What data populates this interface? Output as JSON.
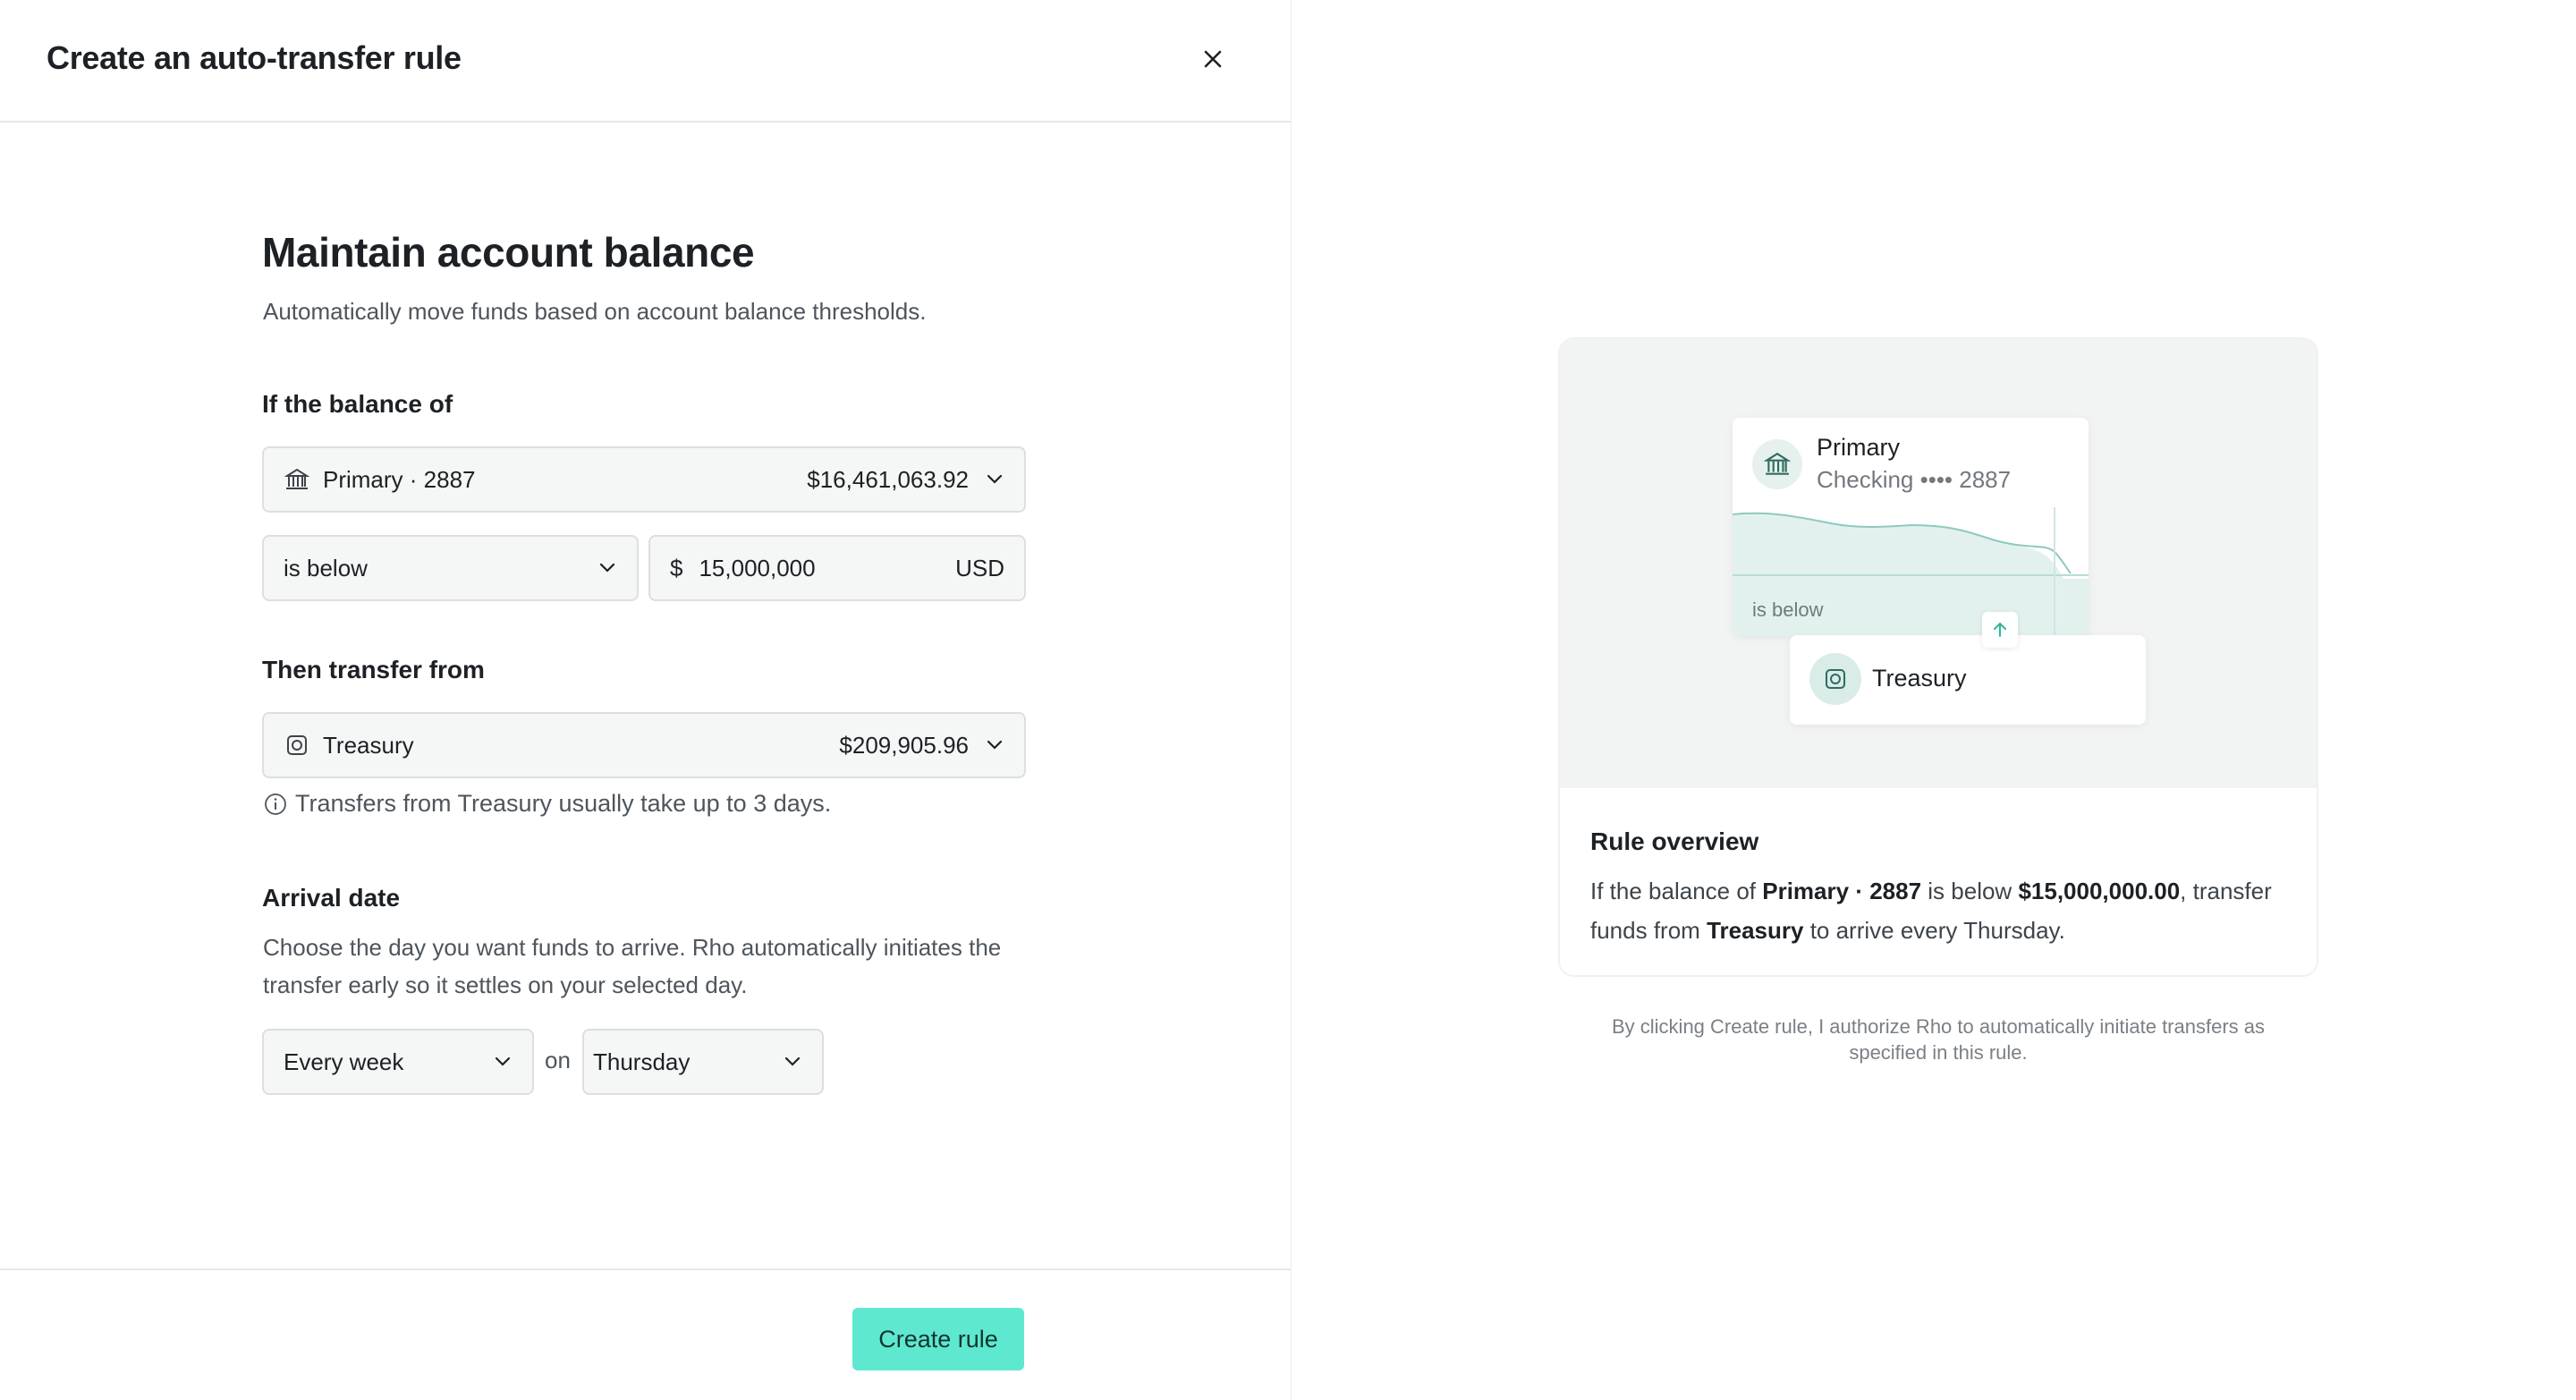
{
  "header": {
    "title": "Create an auto-transfer rule"
  },
  "main": {
    "title": "Maintain account balance",
    "subtitle": "Automatically move funds based on account balance thresholds.",
    "balance_section": {
      "label": "If the balance of",
      "account_name": "Primary · 2887",
      "account_balance": "$16,461,063.92",
      "condition": "is below",
      "currency_symbol": "$",
      "amount": "15,000,000",
      "currency": "USD"
    },
    "transfer_section": {
      "label": "Then transfer from",
      "account_name": "Treasury",
      "account_balance": "$209,905.96",
      "note": "Transfers from Treasury usually take up to 3 days."
    },
    "arrival_section": {
      "label": "Arrival date",
      "description": "Choose the day you want funds to arrive. Rho automatically initiates the transfer early so it settles on your selected day.",
      "frequency": "Every week",
      "on_label": "on",
      "day": "Thursday"
    }
  },
  "footer": {
    "create_label": "Create rule"
  },
  "preview": {
    "primary_name": "Primary",
    "primary_sub": "Checking •••• 2887",
    "below_label": "is below",
    "treasury_name": "Treasury",
    "overview_title": "Rule overview",
    "overview": {
      "t1": "If the balance of ",
      "b1": "Primary · 2887",
      "t2": " is below ",
      "b2": "$15,000,000.00",
      "t3": ", transfer funds from ",
      "b3": "Treasury",
      "t4": " to arrive every Thursday."
    },
    "disclaimer": "By clicking Create rule, I authorize Rho to automatically initiate transfers as specified in this rule."
  },
  "colors": {
    "accent": "#5ee8d0",
    "teal_line": "#8fc9bf",
    "teal_fill": "#d6ece8"
  }
}
